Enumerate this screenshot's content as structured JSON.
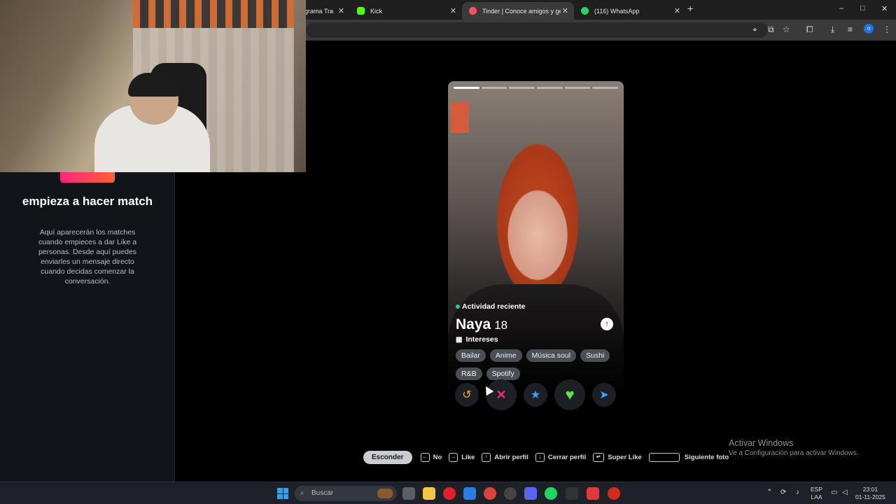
{
  "browser": {
    "tabs": [
      {
        "label": "ograma Tra",
        "active": false
      },
      {
        "label": "Kick",
        "active": false
      },
      {
        "label": "Tinder | Conoce amigos y gente",
        "active": true
      },
      {
        "label": "(116) WhatsApp",
        "active": false
      }
    ],
    "new_tab": "+",
    "window_controls": [
      "–",
      "□",
      "✕"
    ],
    "profile_initial": "o"
  },
  "sidebar": {
    "title": "empieza a hacer match",
    "description": "Aquí aparecerán los matches cuando empieces a dar Like a personas. Desde aquí puedes enviarles un mensaje directo cuando decidas comenzar la conversación."
  },
  "profile": {
    "activity": "Actividad reciente",
    "name": "Naya",
    "age": "18",
    "interests_label": "Intereses",
    "interests": [
      "Bailar",
      "Anime",
      "Música soul",
      "Sushi",
      "R&B",
      "Spotify"
    ],
    "photo_count": 6,
    "current_photo": 1,
    "expand_icon": "arrow-up-icon"
  },
  "actions": [
    {
      "name": "rewind-button",
      "icon": "rewind-icon",
      "glyph": "↺",
      "color": "#f5a623"
    },
    {
      "name": "nope-button",
      "icon": "x-icon",
      "glyph": "✕",
      "color": "#fd267a"
    },
    {
      "name": "superlike-button",
      "icon": "star-icon",
      "glyph": "★",
      "color": "#3ca4ff"
    },
    {
      "name": "like-button",
      "icon": "heart-icon",
      "glyph": "♥",
      "color": "#5fe34b"
    },
    {
      "name": "boost-button",
      "icon": "send-icon",
      "glyph": "➤",
      "color": "#3ca4ff"
    }
  ],
  "hints": {
    "hide_label": "Esconder",
    "no_label": "No",
    "like_label": "Like",
    "open_label": "Abrir perfil",
    "close_label": "Cerrar perfil",
    "superlike_label": "Super Like",
    "next_label": "Siguiente foto"
  },
  "windows_activation": {
    "line1": "Activar Windows",
    "line2": "Ve a Configuración para activar Windows."
  },
  "taskbar": {
    "search_placeholder": "Buscar",
    "language": "ESP",
    "region": "LAA",
    "time": "23:01",
    "date": "01-11-2025"
  },
  "colors": {
    "brand_gradient_start": "#fd267a",
    "brand_gradient_end": "#ff6036",
    "online_dot": "#21d07c"
  }
}
